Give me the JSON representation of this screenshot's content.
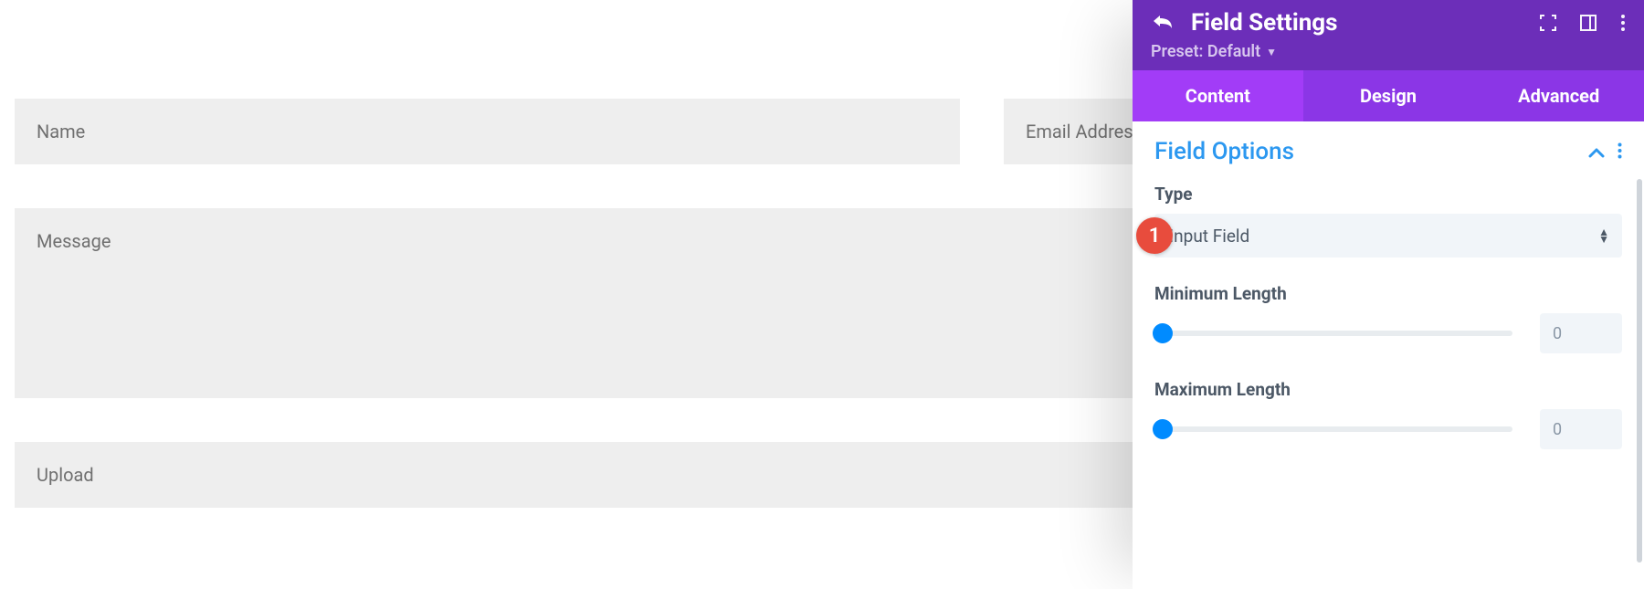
{
  "form": {
    "name_placeholder": "Name",
    "email_placeholder": "Email Address",
    "message_placeholder": "Message",
    "upload_placeholder": "Upload"
  },
  "panel": {
    "title": "Field Settings",
    "preset_label": "Preset: Default",
    "tabs": {
      "content": "Content",
      "design": "Design",
      "advanced": "Advanced"
    },
    "section_title": "Field Options",
    "type_label": "Type",
    "type_value": "Input Field",
    "badge_number": "1",
    "min_length_label": "Minimum Length",
    "min_length_value": "0",
    "max_length_label": "Maximum Length",
    "max_length_value": "0"
  }
}
